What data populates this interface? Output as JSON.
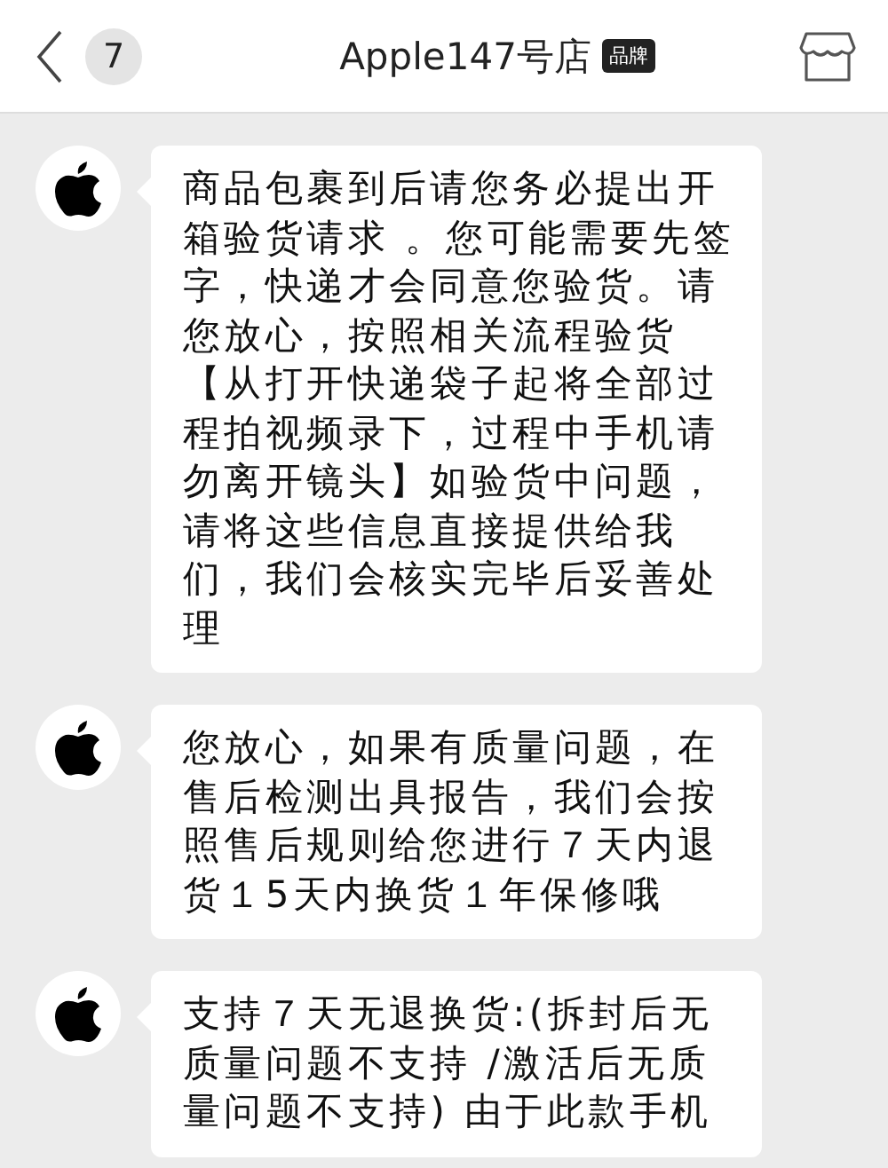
{
  "header": {
    "unread_count": "7",
    "title": "Apple147号店",
    "tag": "品牌"
  },
  "messages": [
    {
      "text": "商品包裹到后请您务必提出开箱验货请求 。您可能需要先签字，快递才会同意您验货。请您放心，按照相关流程验货【从打开快递袋子起将全部过程拍视频录下，过程中手机请勿离开镜头】如验货中问题，请将这些信息直接提供给我们，我们会核实完毕后妥善处理"
    },
    {
      "text": "您放心，如果有质量问题，在售后检测出具报告，我们会按照售后规则给您进行７天内退货１5天内换货１年保修哦"
    },
    {
      "text": "支持７天无退换货:(拆封后无质量问题不支持 /激活后无质量问题不支持) 由于此款手机"
    }
  ]
}
